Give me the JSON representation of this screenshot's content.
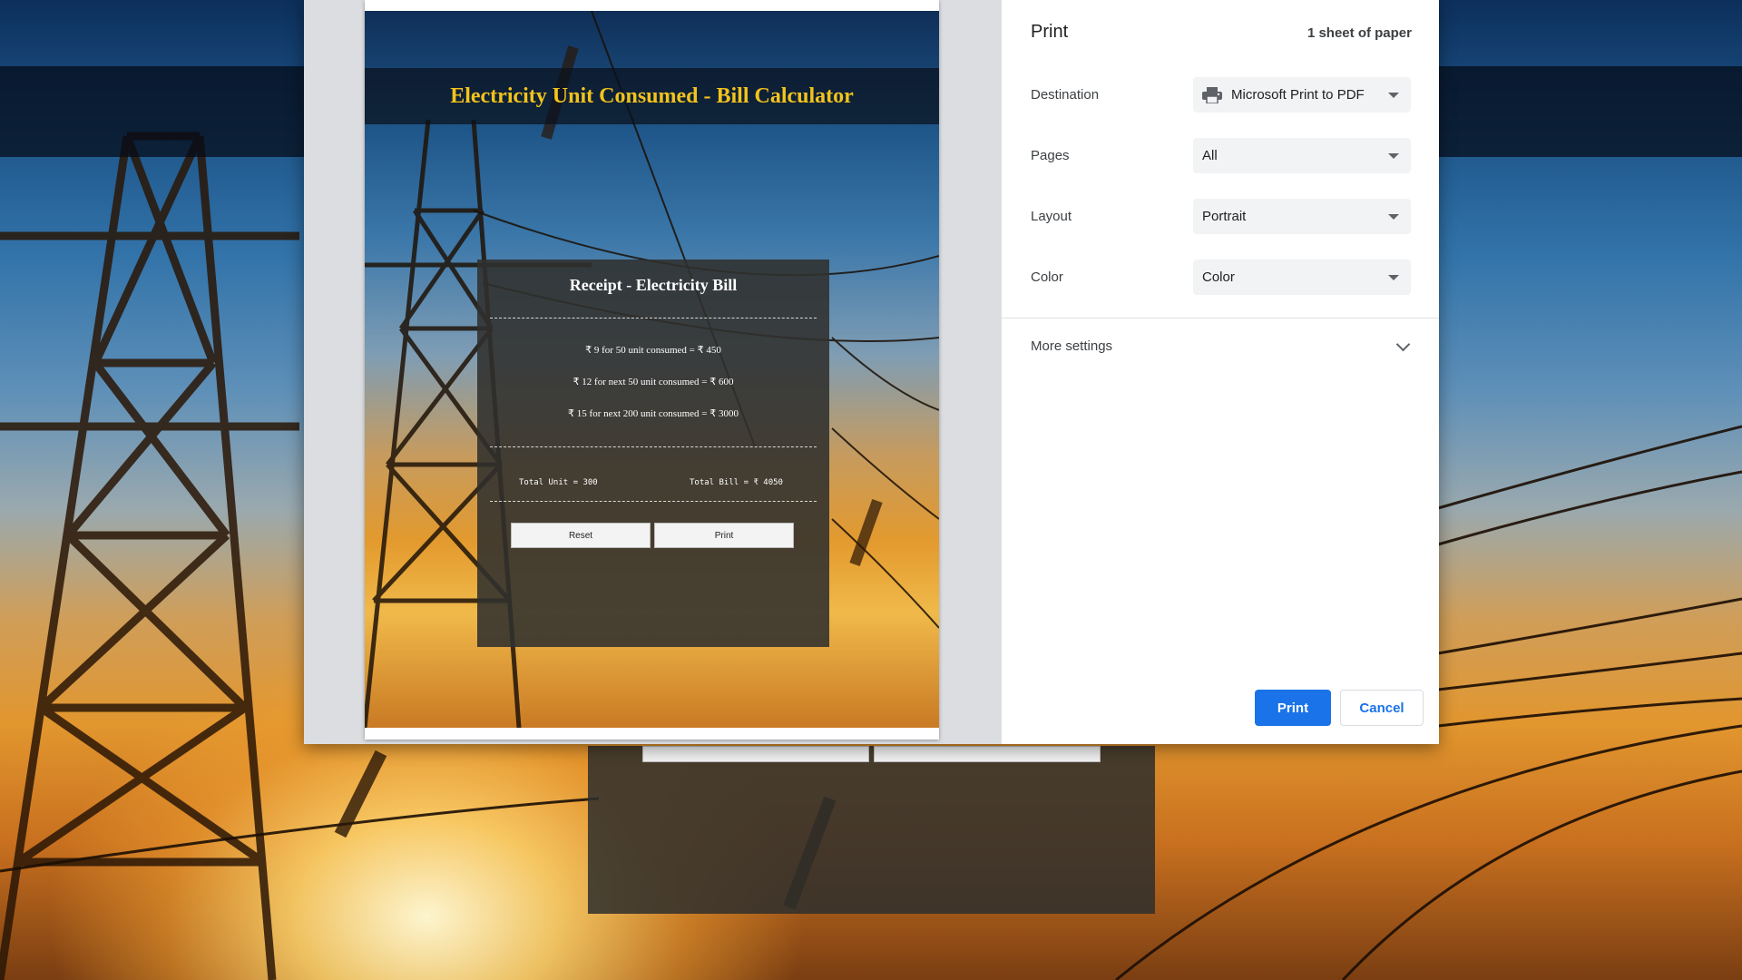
{
  "preview": {
    "page_title": "Electricity Unit Consumed - Bill Calculator",
    "receipt": {
      "title": "Receipt - Electricity Bill",
      "lines": [
        "₹ 9 for 50 unit consumed = ₹ 450",
        "₹ 12 for next 50 unit consumed = ₹ 600",
        "₹ 15 for next 200 unit consumed = ₹ 3000"
      ],
      "total_unit": "Total Unit = 300",
      "total_bill": "Total Bill = ₹ 4050",
      "reset_label": "Reset",
      "print_label": "Print"
    }
  },
  "print_dialog": {
    "title": "Print",
    "sheet_count": "1 sheet of paper",
    "destination": {
      "label": "Destination",
      "value": "Microsoft Print to PDF",
      "icon": "printer-icon"
    },
    "pages": {
      "label": "Pages",
      "value": "All"
    },
    "layout": {
      "label": "Layout",
      "value": "Portrait"
    },
    "color": {
      "label": "Color",
      "value": "Color"
    },
    "more_settings": "More settings",
    "print_button": "Print",
    "cancel_button": "Cancel"
  },
  "colors": {
    "accent": "#1a73e8",
    "title_gold": "#f2c31c"
  }
}
